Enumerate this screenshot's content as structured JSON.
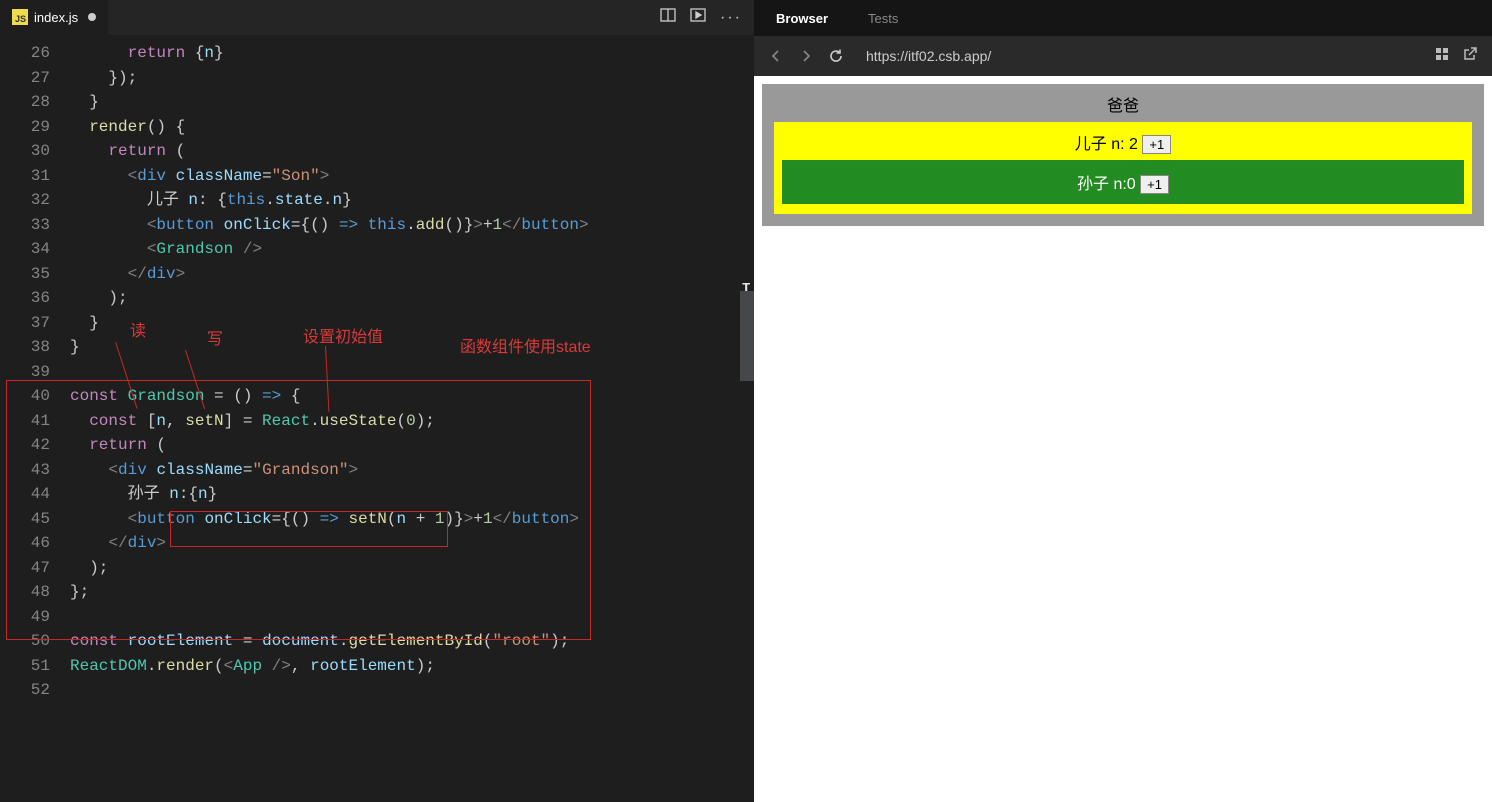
{
  "editor": {
    "tab": {
      "icon_label": "JS",
      "filename": "index.js",
      "dirty": true
    },
    "line_start": 26,
    "line_end": 52,
    "code_lines": [
      "      return {n}",
      "    });",
      "  }",
      "  render() {",
      "    return (",
      "      <div className=\"Son\">",
      "        儿子 n: {this.state.n}",
      "        <button onClick={() => this.add()}>+1</button>",
      "        <Grandson />",
      "      </div>",
      "    );",
      "  }",
      "}",
      "",
      "const Grandson = () => {",
      "  const [n, setN] = React.useState(0);",
      "  return (",
      "    <div className=\"Grandson\">",
      "      孙子 n:{n}",
      "      <button onClick={() => setN(n + 1)}>+1</button>",
      "    </div>",
      "  );",
      "};",
      "",
      "const rootElement = document.getElementById(\"root\");",
      "ReactDOM.render(<App />, rootElement);",
      ""
    ],
    "annotations": {
      "read": "读",
      "write": "写",
      "init": "设置初始值",
      "comment": "函数组件使用state"
    }
  },
  "preview": {
    "tabs": {
      "browser": "Browser",
      "tests": "Tests"
    },
    "url": "https://itf02.csb.app/",
    "app": {
      "dad_label": "爸爸",
      "son_label_prefix": "儿子 n: ",
      "son_n": "2",
      "grandson_label_prefix": "孙子 n:",
      "grandson_n": "0",
      "plus_label": "+1"
    }
  }
}
